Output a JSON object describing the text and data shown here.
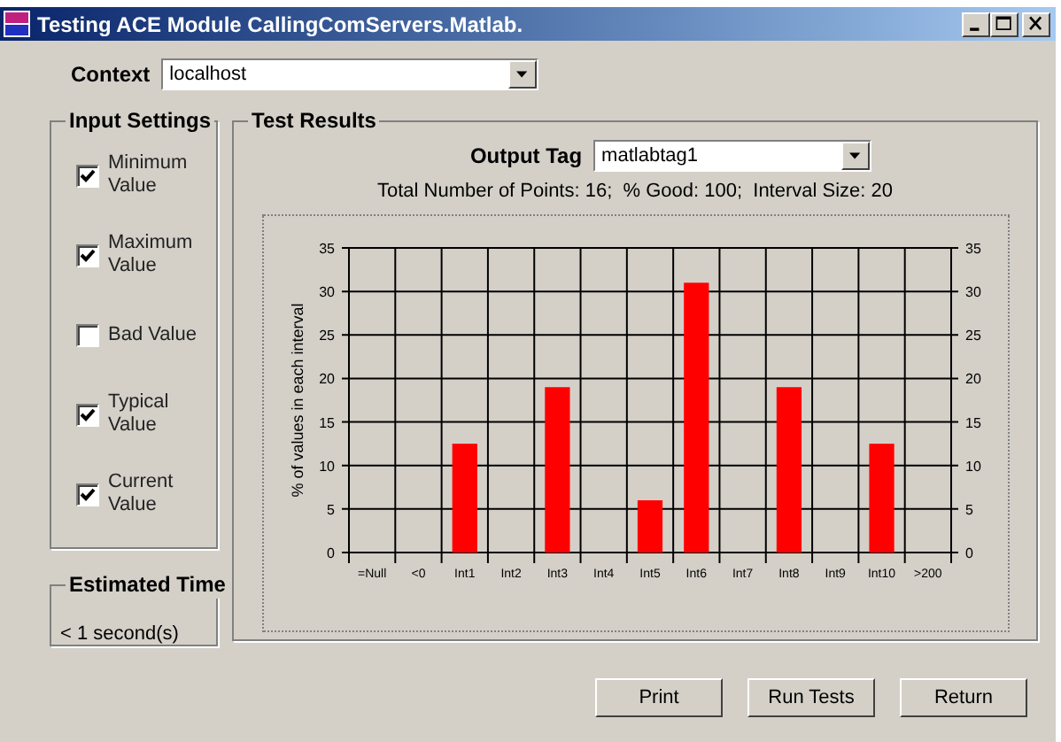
{
  "window": {
    "title": "Testing ACE Module CallingComServers.Matlab."
  },
  "context": {
    "label": "Context",
    "value": "localhost"
  },
  "input_settings": {
    "title": "Input Settings",
    "items": [
      {
        "label": "Minimum Value",
        "checked": true
      },
      {
        "label": "Maximum Value",
        "checked": true
      },
      {
        "label": "Bad Value",
        "checked": false
      },
      {
        "label": "Typical Value",
        "checked": true
      },
      {
        "label": "Current Value",
        "checked": true
      }
    ]
  },
  "estimated_time": {
    "title": "Estimated Time",
    "value": "< 1 second(s)"
  },
  "test_results": {
    "title": "Test Results",
    "output_tag": {
      "label": "Output Tag",
      "value": "matlabtag1"
    },
    "summary": "Total Number of Points: 16;  % Good: 100;  Interval Size: 20",
    "chart_data": {
      "type": "bar",
      "ylabel": "% of values in each interval",
      "categories": [
        "=Null",
        "<0",
        "Int1",
        "Int2",
        "Int3",
        "Int4",
        "Int5",
        "Int6",
        "Int7",
        "Int8",
        "Int9",
        "Int10",
        ">200"
      ],
      "values": [
        0,
        0,
        12.5,
        0,
        19,
        0,
        6,
        31,
        0,
        19,
        0,
        12.5,
        0
      ],
      "ylim": [
        0,
        35
      ],
      "yticks": [
        0,
        5,
        10,
        15,
        20,
        25,
        30,
        35
      ],
      "y2ticks": [
        0,
        5,
        10,
        15,
        20,
        25,
        30,
        35
      ],
      "y2lim": [
        0,
        35
      ],
      "grid": true
    }
  },
  "buttons": [
    "Print",
    "Run Tests",
    "Return"
  ]
}
